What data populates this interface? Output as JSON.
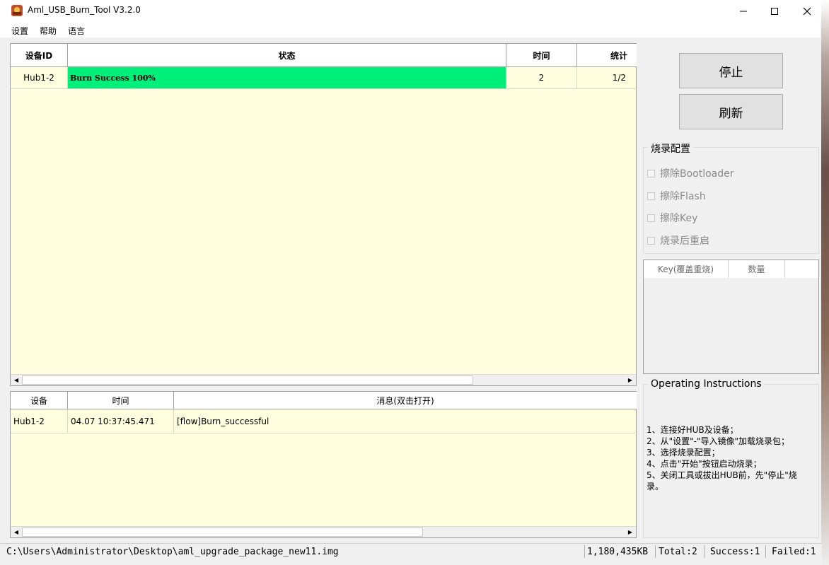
{
  "window": {
    "title": "Aml_USB_Burn_Tool V3.2.0",
    "icon": "app-flame-icon",
    "controls": [
      "minimize-icon",
      "maximize-icon",
      "close-icon"
    ]
  },
  "menu": {
    "settings": "设置",
    "help": "帮助",
    "language": "语言"
  },
  "device_table": {
    "headers": {
      "id": "设备ID",
      "status": "状态",
      "time": "时间",
      "stats": "统计"
    },
    "rows": [
      {
        "id": "Hub1-2",
        "status": "Burn Success 100%",
        "time": "2",
        "stats": "1/2"
      }
    ],
    "status_color": "#00ee7a"
  },
  "log_table": {
    "headers": {
      "device": "设备",
      "time": "时间",
      "message": "消息(双击打开)"
    },
    "rows": [
      {
        "device": "Hub1-2",
        "time": "04.07 10:37:45.471",
        "message": "[flow]Burn_successful"
      }
    ]
  },
  "buttons": {
    "stop": "停止",
    "refresh": "刷新"
  },
  "burn_config": {
    "title": "烧录配置",
    "options": [
      {
        "label": "擦除Bootloader",
        "checked": false
      },
      {
        "label": "擦除Flash",
        "checked": false
      },
      {
        "label": "擦除Key",
        "checked": false
      },
      {
        "label": "烧录后重启",
        "checked": false
      }
    ]
  },
  "key_table": {
    "headers": {
      "key": "Key(覆盖重烧)",
      "count": "数量"
    }
  },
  "instructions": {
    "title": "Operating Instructions",
    "lines": [
      "1、连接好HUB及设备；",
      "2、从\"设置\"-\"导入镜像\"加载烧录包；",
      "3、选择烧录配置；",
      "4、点击\"开始\"按钮启动烧录；",
      "5、关闭工具或拔出HUB前，先\"停止\"烧",
      "录。"
    ]
  },
  "statusbar": {
    "path": "C:\\Users\\Administrator\\Desktop\\aml_upgrade_package_new11.img",
    "size": "1,180,435KB",
    "total": "Total:2",
    "success": "Success:1",
    "failed": "Failed:1"
  }
}
